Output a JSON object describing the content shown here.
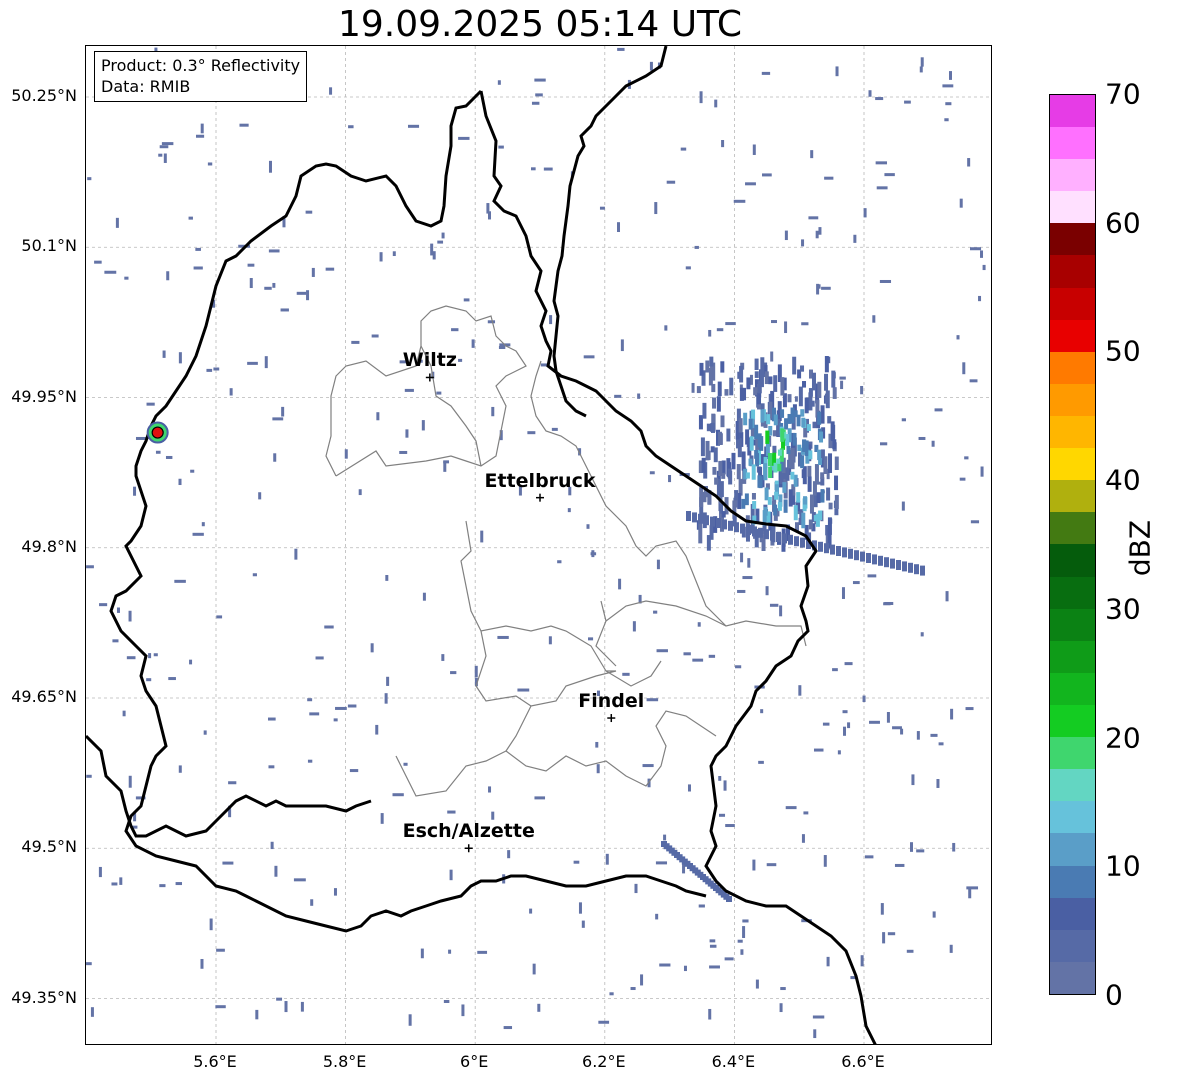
{
  "title": "19.09.2025 05:14 UTC",
  "info": {
    "product": "Product: 0.3° Reflectivity",
    "data": "Data: RMIB"
  },
  "axes": {
    "lat_labels": [
      "50.25°N",
      "50.1°N",
      "49.95°N",
      "49.8°N",
      "49.65°N",
      "49.5°N",
      "49.35°N"
    ],
    "lat_values": [
      50.25,
      50.1,
      49.95,
      49.8,
      49.65,
      49.5,
      49.35
    ],
    "lon_labels": [
      "5.6°E",
      "5.8°E",
      "6°E",
      "6.2°E",
      "6.4°E",
      "6.6°E"
    ],
    "lon_values": [
      5.6,
      5.8,
      6.0,
      6.2,
      6.4,
      6.6
    ],
    "grid": true
  },
  "cities": [
    {
      "name": "Wiltz",
      "lon": 5.93,
      "lat": 49.97
    },
    {
      "name": "Ettelbruck",
      "lon": 6.1,
      "lat": 49.85
    },
    {
      "name": "Findel",
      "lon": 6.21,
      "lat": 49.63
    },
    {
      "name": "Esch/Alzette",
      "lon": 5.99,
      "lat": 49.5
    }
  ],
  "radar_site": {
    "lon": 5.51,
    "lat": 49.915,
    "color": "#e01010"
  },
  "colorbar": {
    "label": "dBZ",
    "min": 0,
    "max": 70,
    "step": 2.5,
    "tick_labels": [
      "0",
      "10",
      "20",
      "30",
      "40",
      "50",
      "60",
      "70"
    ],
    "tick_values": [
      0,
      10,
      20,
      30,
      40,
      50,
      60,
      70
    ],
    "colors": [
      "#6373a6",
      "#566aa6",
      "#4a5fa3",
      "#4a7bb3",
      "#5a9ec8",
      "#66c2db",
      "#63d6c2",
      "#3fd66e",
      "#14cc22",
      "#12b51e",
      "#0f9c18",
      "#0b8214",
      "#086e10",
      "#055c0c",
      "#437a12",
      "#b0b00e",
      "#ffd700",
      "#ffb600",
      "#ff9a00",
      "#ff7a00",
      "#e80000",
      "#c80000",
      "#a80000",
      "#7a0000",
      "#ffe0ff",
      "#ffb0ff",
      "#ff70ff",
      "#e63ce6"
    ]
  },
  "styles": {
    "border_color": "#000000",
    "canton_color": "#808080",
    "grid_color": "#b8b8b8"
  }
}
